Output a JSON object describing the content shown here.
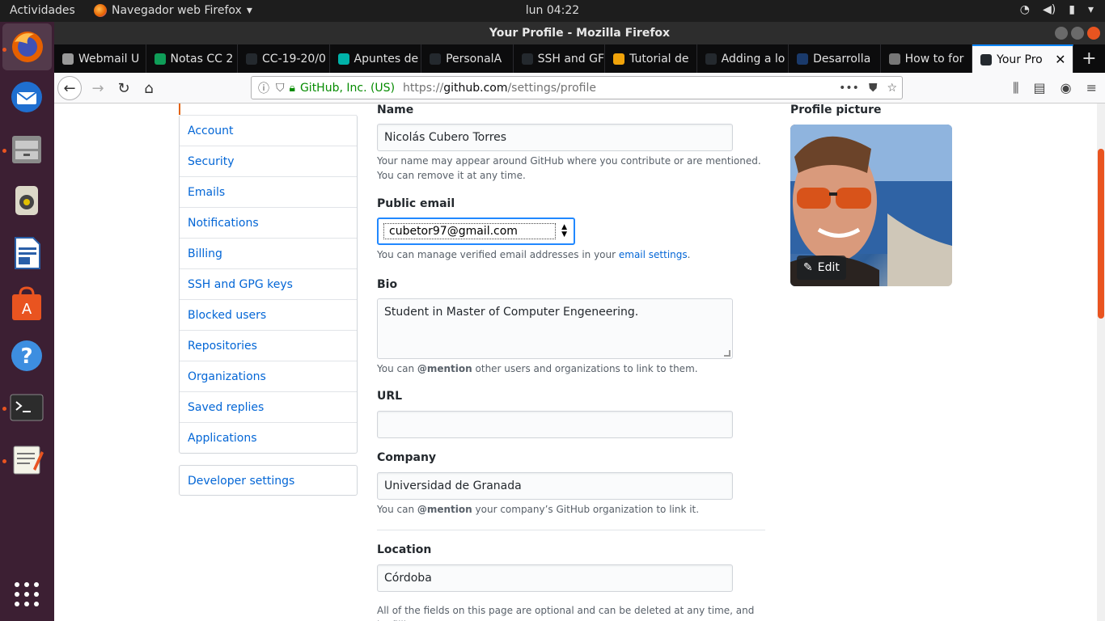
{
  "topbar": {
    "activities": "Actividades",
    "app_menu": "Navegador web Firefox",
    "clock": "lun 04:22"
  },
  "window": {
    "title": "Your Profile - Mozilla Firefox"
  },
  "tabs": [
    {
      "label": "Webmail U",
      "color": "#999999"
    },
    {
      "label": "Notas CC 2",
      "color": "#0f9d58"
    },
    {
      "label": "CC-19-20/0",
      "color": "#24292e"
    },
    {
      "label": "Apuntes de",
      "color": "#00b2a9"
    },
    {
      "label": "PersonalA",
      "color": "#24292e"
    },
    {
      "label": "SSH and GF",
      "color": "#24292e"
    },
    {
      "label": "Tutorial de",
      "color": "#f0a30a"
    },
    {
      "label": "Adding a lo",
      "color": "#24292e"
    },
    {
      "label": "Desarrolla",
      "color": "#1a3a6b"
    },
    {
      "label": "How to for",
      "color": "#777777"
    },
    {
      "label": "Your Pro",
      "color": "#24292e"
    }
  ],
  "urlbar": {
    "identity": "GitHub, Inc. (US)",
    "url_prefix": "https://",
    "url_host": "github.com",
    "url_path": "/settings/profile"
  },
  "sidebar": {
    "items": [
      {
        "label": "Account"
      },
      {
        "label": "Security"
      },
      {
        "label": "Emails"
      },
      {
        "label": "Notifications"
      },
      {
        "label": "Billing"
      },
      {
        "label": "SSH and GPG keys"
      },
      {
        "label": "Blocked users"
      },
      {
        "label": "Repositories"
      },
      {
        "label": "Organizations"
      },
      {
        "label": "Saved replies"
      },
      {
        "label": "Applications"
      }
    ],
    "developer_settings": "Developer settings"
  },
  "form": {
    "name_label": "Name",
    "name_value": "Nicolás Cubero Torres",
    "name_note": "Your name may appear around GitHub where you contribute or are mentioned. You can remove it at any time.",
    "email_label": "Public email",
    "email_value": "cubetor97@gmail.com",
    "email_note_pre": "You can manage verified email addresses in your ",
    "email_note_link": "email settings",
    "email_note_post": ".",
    "bio_label": "Bio",
    "bio_value": "Student in Master of Computer Engeneering.",
    "bio_note_pre": "You can ",
    "bio_note_mention": "@mention",
    "bio_note_post": " other users and organizations to link to them.",
    "url_label": "URL",
    "url_value": "",
    "company_label": "Company",
    "company_value": "Universidad de Granada",
    "company_note_pre": "You can ",
    "company_note_mention": "@mention",
    "company_note_post": " your company’s GitHub organization to link it.",
    "location_label": "Location",
    "location_value": "Córdoba",
    "footer_note": "All of the fields on this page are optional and can be deleted at any time, and by filling"
  },
  "profile_picture": {
    "label": "Profile picture",
    "edit_label": "Edit"
  }
}
